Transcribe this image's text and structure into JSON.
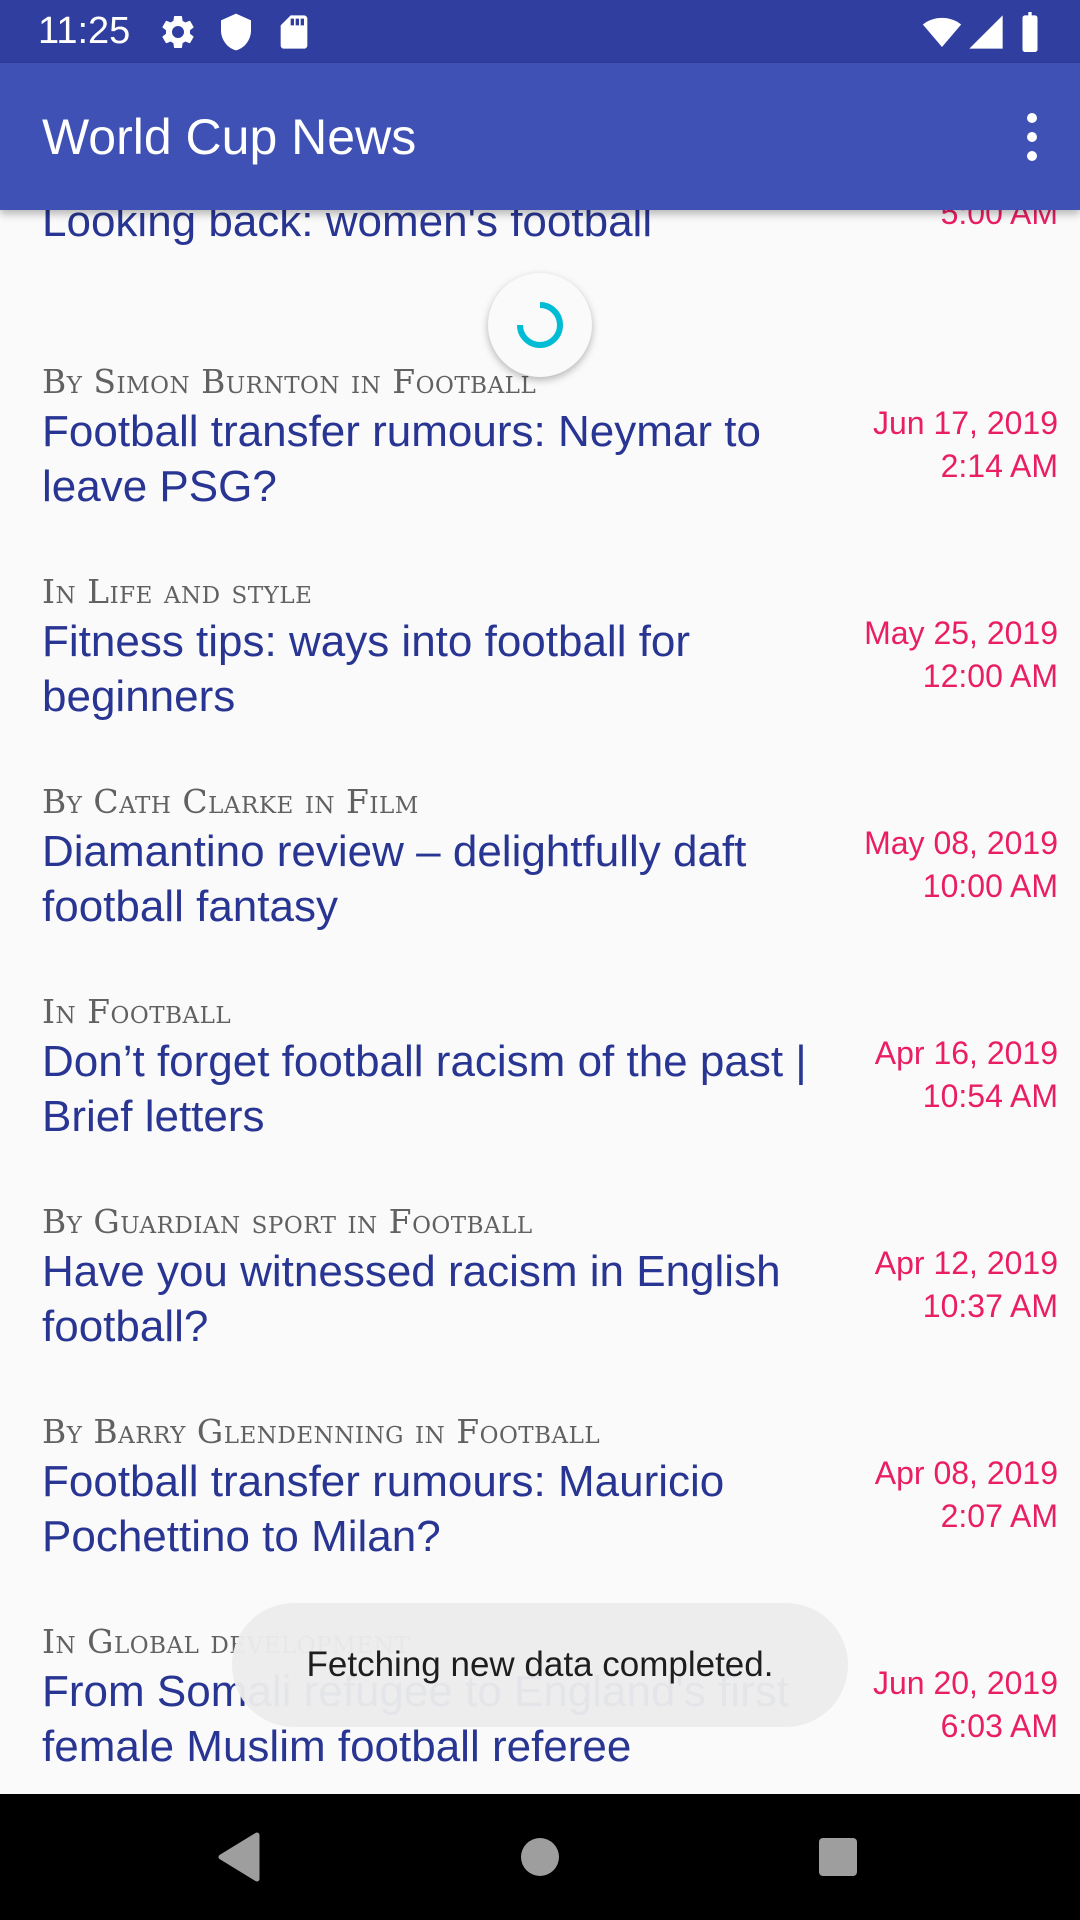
{
  "status_bar": {
    "time": "11:25",
    "icons": [
      "gear-icon",
      "shield-icon",
      "sd-card-icon",
      "wifi-icon",
      "cell-signal-icon",
      "battery-icon"
    ]
  },
  "app_bar": {
    "title": "World Cup News",
    "menu_icon": "more-vert-icon"
  },
  "articles": [
    {
      "meta": "",
      "title": "Looking back: women's football",
      "date": "",
      "time": "5:00 AM"
    },
    {
      "meta": "By Simon Burnton in Football",
      "title": "Football transfer rumours: Neymar to leave PSG?",
      "date": "Jun 17, 2019",
      "time": "2:14 AM"
    },
    {
      "meta": "In Life and style",
      "title": "Fitness tips: ways into football for beginners",
      "date": "May 25, 2019",
      "time": "12:00 AM"
    },
    {
      "meta": "By Cath Clarke in Film",
      "title": "Diamantino review – delightfully daft football fantasy",
      "date": "May 08, 2019",
      "time": "10:00 AM"
    },
    {
      "meta": "In Football",
      "title": "Don’t forget football racism of the past | Brief letters",
      "date": "Apr 16, 2019",
      "time": "10:54 AM"
    },
    {
      "meta": "By Guardian sport in Football",
      "title": "Have you witnessed racism in English football?",
      "date": "Apr 12, 2019",
      "time": "10:37 AM"
    },
    {
      "meta": "By Barry Glendenning in Football",
      "title": "Football transfer rumours: Mauricio Pochettino to Milan?",
      "date": "Apr 08, 2019",
      "time": "2:07 AM"
    },
    {
      "meta": "In Global development",
      "title": "From Somali refugee to England's first female Muslim football referee",
      "date": "Jun 20, 2019",
      "time": "6:03 AM"
    }
  ],
  "toast": {
    "message": "Fetching new data completed."
  },
  "nav_bar": {
    "icons": [
      "back-icon",
      "home-icon",
      "recents-icon"
    ]
  },
  "colors": {
    "status_bar": "#303f9f",
    "app_bar": "#3f51b5",
    "title_text": "#283593",
    "date_text": "#e91e63",
    "meta_text": "#616161",
    "spinner": "#00bcd4"
  }
}
